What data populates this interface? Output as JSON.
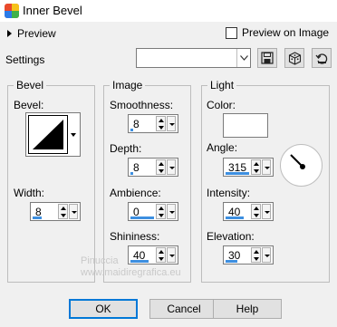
{
  "window": {
    "title": "Inner Bevel"
  },
  "preview": {
    "label": "Preview",
    "on_image_label": "Preview on Image"
  },
  "settings": {
    "label": "Settings",
    "selected": ""
  },
  "bevel_group": {
    "title": "Bevel",
    "bevel_label": "Bevel:",
    "width_label": "Width:",
    "width_value": "8"
  },
  "image_group": {
    "title": "Image",
    "smoothness_label": "Smoothness:",
    "smoothness_value": "8",
    "depth_label": "Depth:",
    "depth_value": "8",
    "ambience_label": "Ambience:",
    "ambience_value": "0",
    "shininess_label": "Shininess:",
    "shininess_value": "40"
  },
  "light_group": {
    "title": "Light",
    "color_label": "Color:",
    "color_value": "#ffffff",
    "angle_label": "Angle:",
    "angle_value": "315",
    "intensity_label": "Intensity:",
    "intensity_value": "40",
    "elevation_label": "Elevation:",
    "elevation_value": "30"
  },
  "buttons": {
    "ok": "OK",
    "cancel": "Cancel",
    "help": "Help"
  },
  "watermark": {
    "line1": "Pinuccia",
    "line2": "www.maidiregrafica.eu"
  },
  "colors": {
    "accent": "#0078d7",
    "slider_fill": "#3d8fe0"
  }
}
